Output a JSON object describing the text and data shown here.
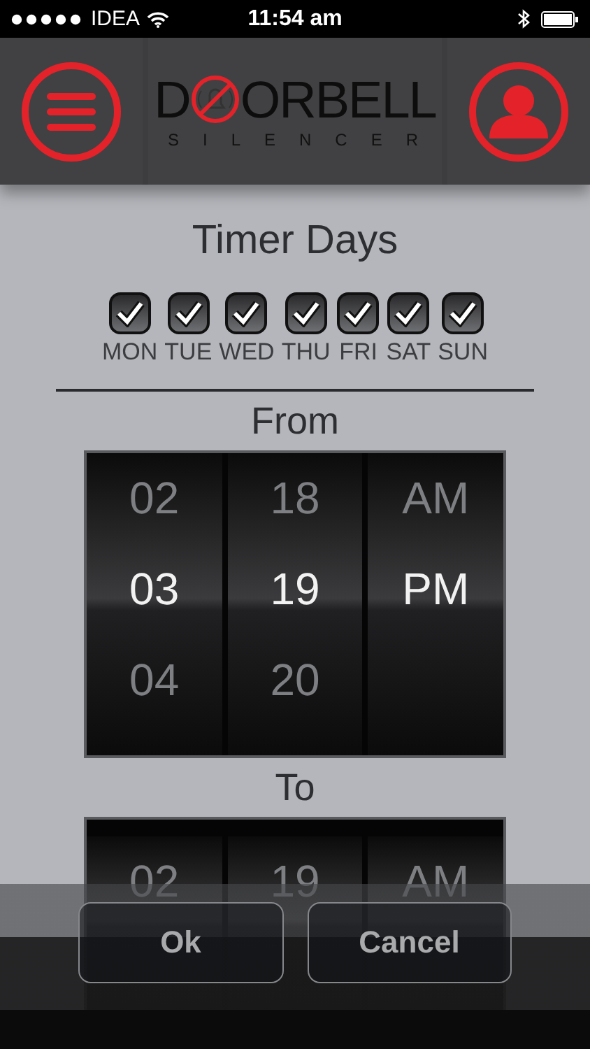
{
  "status_bar": {
    "carrier": "IDEA",
    "time": "11:54 am"
  },
  "header": {
    "logo": {
      "before": "D",
      "after": "ORBELL",
      "subtitle": "SILENCER"
    }
  },
  "title": "Timer Days",
  "days": [
    {
      "label": "MON",
      "checked": true
    },
    {
      "label": "TUE",
      "checked": true
    },
    {
      "label": "WED",
      "checked": true
    },
    {
      "label": "THU",
      "checked": true
    },
    {
      "label": "FRI",
      "checked": true
    },
    {
      "label": "SAT",
      "checked": true
    },
    {
      "label": "SUN",
      "checked": true
    }
  ],
  "pickers": [
    {
      "label": "From",
      "columns": [
        [
          {
            "text": "02",
            "selected": false
          },
          {
            "text": "03",
            "selected": true
          },
          {
            "text": "04",
            "selected": false
          }
        ],
        [
          {
            "text": "18",
            "selected": false
          },
          {
            "text": "19",
            "selected": true
          },
          {
            "text": "20",
            "selected": false
          }
        ],
        [
          {
            "text": "AM",
            "selected": false
          },
          {
            "text": "PM",
            "selected": true
          }
        ]
      ]
    },
    {
      "label": "To",
      "columns": [
        [
          {
            "text": "02",
            "selected": false
          }
        ],
        [
          {
            "text": "19",
            "selected": false
          }
        ],
        [
          {
            "text": "AM",
            "selected": false
          }
        ]
      ]
    }
  ],
  "buttons": [
    {
      "label": "Ok"
    },
    {
      "label": "Cancel"
    }
  ]
}
